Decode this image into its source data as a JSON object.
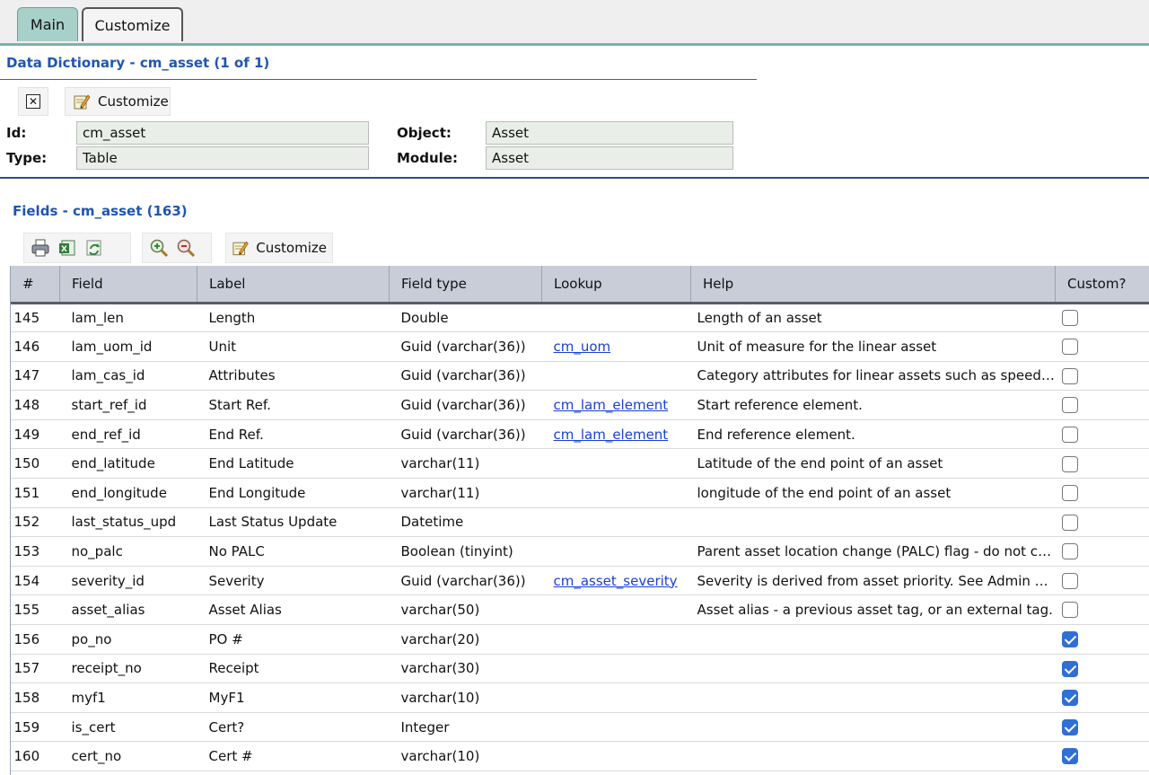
{
  "tabs": [
    {
      "label": "Main",
      "active": true
    },
    {
      "label": "Customize",
      "active": false
    }
  ],
  "dictionary": {
    "title": "Data Dictionary - cm_asset (1 of 1)",
    "customize_label": "Customize",
    "id_label": "Id:",
    "id_value": "cm_asset",
    "type_label": "Type:",
    "type_value": "Table",
    "object_label": "Object:",
    "object_value": "Asset",
    "module_label": "Module:",
    "module_value": "Asset"
  },
  "fields": {
    "title": "Fields - cm_asset (163)",
    "customize_label": "Customize",
    "toolbar_icons": [
      "print-icon",
      "export-excel-icon",
      "refresh-icon",
      "zoom-in-icon",
      "zoom-out-icon",
      "customize-icon"
    ],
    "columns": [
      "#",
      "Field",
      "Label",
      "Field type",
      "Lookup",
      "Help",
      "Custom?"
    ],
    "rows": [
      {
        "num": "145",
        "field": "lam_len",
        "label": "Length",
        "type": "Double",
        "lookup": "",
        "help": "Length of an asset",
        "custom": false
      },
      {
        "num": "146",
        "field": "lam_uom_id",
        "label": "Unit",
        "type": "Guid (varchar(36))",
        "lookup": "cm_uom",
        "help": "Unit of measure for the linear asset",
        "custom": false
      },
      {
        "num": "147",
        "field": "lam_cas_id",
        "label": "Attributes",
        "type": "Guid (varchar(36))",
        "lookup": "",
        "help": "Category attributes for linear assets such as speed li…",
        "custom": false
      },
      {
        "num": "148",
        "field": "start_ref_id",
        "label": "Start Ref.",
        "type": "Guid (varchar(36))",
        "lookup": "cm_lam_element",
        "help": "Start reference element.",
        "custom": false
      },
      {
        "num": "149",
        "field": "end_ref_id",
        "label": "End Ref.",
        "type": "Guid (varchar(36))",
        "lookup": "cm_lam_element",
        "help": "End reference element.",
        "custom": false
      },
      {
        "num": "150",
        "field": "end_latitude",
        "label": "End Latitude",
        "type": "varchar(11)",
        "lookup": "",
        "help": "Latitude of the end point of an asset",
        "custom": false
      },
      {
        "num": "151",
        "field": "end_longitude",
        "label": "End Longitude",
        "type": "varchar(11)",
        "lookup": "",
        "help": "longitude of the end point of an asset",
        "custom": false
      },
      {
        "num": "152",
        "field": "last_status_upd",
        "label": "Last Status Update",
        "type": "Datetime",
        "lookup": "",
        "help": "",
        "custom": false
      },
      {
        "num": "153",
        "field": "no_palc",
        "label": "No PALC",
        "type": "Boolean (tinyint)",
        "lookup": "",
        "help": "Parent asset location change (PALC) flag - do not ch…",
        "custom": false
      },
      {
        "num": "154",
        "field": "severity_id",
        "label": "Severity",
        "type": "Guid (varchar(36))",
        "lookup": "cm_asset_severity",
        "help": "Severity is derived from asset priority. See Admin Gu…",
        "custom": false
      },
      {
        "num": "155",
        "field": "asset_alias",
        "label": "Asset Alias",
        "type": "varchar(50)",
        "lookup": "",
        "help": "Asset alias - a previous asset tag, or an external tag.",
        "custom": false
      },
      {
        "num": "156",
        "field": "po_no",
        "label": "PO #",
        "type": "varchar(20)",
        "lookup": "",
        "help": "",
        "custom": true
      },
      {
        "num": "157",
        "field": "receipt_no",
        "label": "Receipt",
        "type": "varchar(30)",
        "lookup": "",
        "help": "",
        "custom": true
      },
      {
        "num": "158",
        "field": "myf1",
        "label": "MyF1",
        "type": "varchar(10)",
        "lookup": "",
        "help": "",
        "custom": true
      },
      {
        "num": "159",
        "field": "is_cert",
        "label": "Cert?",
        "type": "Integer",
        "lookup": "",
        "help": "",
        "custom": true
      },
      {
        "num": "160",
        "field": "cert_no",
        "label": "Cert #",
        "type": "varchar(10)",
        "lookup": "",
        "help": "",
        "custom": true
      }
    ]
  }
}
